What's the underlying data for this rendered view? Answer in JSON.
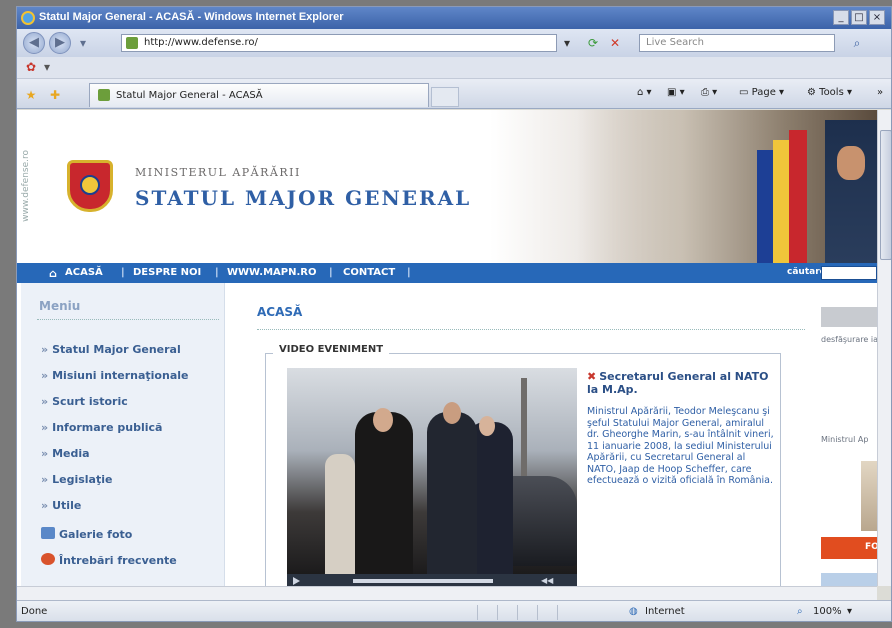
{
  "window": {
    "title": "Statul Major General - ACASĂ - Windows Internet Explorer",
    "controls": [
      "_",
      "□",
      "×"
    ]
  },
  "addressbar": {
    "url": "http://www.defense.ro/",
    "search_placeholder": "Live Search"
  },
  "tab": {
    "title": "Statul Major General - ACASĂ"
  },
  "toolbar": {
    "page_label": "Page",
    "tools_label": "Tools"
  },
  "site": {
    "side_label": "www.defense.ro",
    "ministry": "MINISTERUL APĂRĂRII",
    "title": "STATUL MAJOR GENERAL",
    "nav": [
      "ACASĂ",
      "DESPRE NOI",
      "WWW.MAPN.RO",
      "CONTACT"
    ],
    "nav_sep": "|",
    "search_label": "căutare:"
  },
  "menu": {
    "title": "Meniu",
    "items": [
      "Statul Major General",
      "Misiuni internaţionale",
      "Scurt istoric",
      "Informare publică",
      "Media",
      "Legislaţie",
      "Utile"
    ],
    "icon_items": [
      "Galerie foto",
      "Întrebări frecvente"
    ]
  },
  "content": {
    "page_heading": "ACASĂ",
    "video_label": "VIDEO EVENIMENT",
    "news_title": "Secretarul General al NATO la M.Ap.",
    "news_body": "Ministrul Apărării, Teodor Meleşcanu şi şeful Statului Major General, amiralul dr. Gheorghe Marin, s-au întâlnit vineri, 11 ianuarie 2008, la sediul Ministerului Apărării, cu Secretarul General al NATO, Jaap de Hoop Scheffer, care efectuează o vizită oficială în România."
  },
  "rightcol": {
    "text1": "desfăşurare ianuarie, m populaţiei suburbia Ti a musulma",
    "text2": "Ministrul Ap",
    "button": "FO"
  },
  "status": {
    "left": "Done",
    "zone": "Internet",
    "zoom": "100%"
  }
}
